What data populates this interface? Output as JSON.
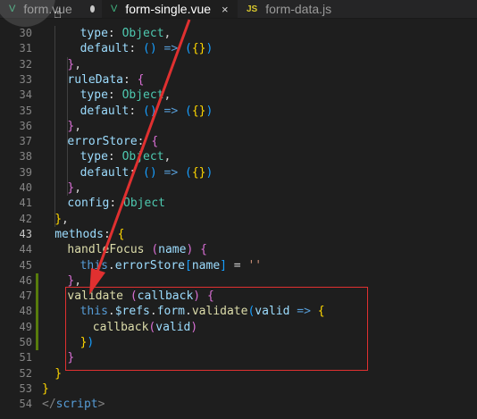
{
  "tabs": [
    {
      "label": "form.vue",
      "type": "vue",
      "modified": true,
      "active": false
    },
    {
      "label": "form-single.vue",
      "type": "vue",
      "modified": false,
      "active": true
    },
    {
      "label": "form-data.js",
      "type": "js",
      "modified": false,
      "active": false
    }
  ],
  "tab_icons": {
    "vue": "V",
    "js": "JS",
    "close": "×"
  },
  "active_line": 43,
  "modified_lines": [
    46,
    47,
    48,
    49,
    50
  ],
  "highlight_box_lines": [
    47,
    52
  ],
  "colors": {
    "highlight_box": "#e03030",
    "arrow": "#e03030",
    "background": "#1e1e1e"
  },
  "code_lines": [
    {
      "n": "30",
      "tokens": [
        [
          "prop",
          "type"
        ],
        [
          "p",
          ": "
        ],
        [
          "type",
          "Object"
        ],
        [
          "p",
          ","
        ]
      ]
    },
    {
      "n": "31",
      "tokens": [
        [
          "prop",
          "default"
        ],
        [
          "p",
          ": "
        ],
        [
          "b3",
          "()"
        ],
        [
          "p",
          " "
        ],
        [
          "kw",
          "=>"
        ],
        [
          "p",
          " "
        ],
        [
          "b3",
          "("
        ],
        [
          "b1",
          "{}"
        ],
        [
          "b3",
          ")"
        ]
      ]
    },
    {
      "n": "32",
      "tokens": [
        [
          "b2",
          "}"
        ],
        [
          "p",
          ","
        ]
      ]
    },
    {
      "n": "33",
      "tokens": [
        [
          "prop",
          "ruleData"
        ],
        [
          "p",
          ": "
        ],
        [
          "b2",
          "{"
        ]
      ]
    },
    {
      "n": "34",
      "tokens": [
        [
          "prop",
          "type"
        ],
        [
          "p",
          ": "
        ],
        [
          "type",
          "Object"
        ],
        [
          "p",
          ","
        ]
      ]
    },
    {
      "n": "35",
      "tokens": [
        [
          "prop",
          "default"
        ],
        [
          "p",
          ": "
        ],
        [
          "b3",
          "()"
        ],
        [
          "p",
          " "
        ],
        [
          "kw",
          "=>"
        ],
        [
          "p",
          " "
        ],
        [
          "b3",
          "("
        ],
        [
          "b1",
          "{}"
        ],
        [
          "b3",
          ")"
        ]
      ]
    },
    {
      "n": "36",
      "tokens": [
        [
          "b2",
          "}"
        ],
        [
          "p",
          ","
        ]
      ]
    },
    {
      "n": "37",
      "tokens": [
        [
          "prop",
          "errorStore"
        ],
        [
          "p",
          ": "
        ],
        [
          "b2",
          "{"
        ]
      ]
    },
    {
      "n": "38",
      "tokens": [
        [
          "prop",
          "type"
        ],
        [
          "p",
          ": "
        ],
        [
          "type",
          "Object"
        ],
        [
          "p",
          ","
        ]
      ]
    },
    {
      "n": "39",
      "tokens": [
        [
          "prop",
          "default"
        ],
        [
          "p",
          ": "
        ],
        [
          "b3",
          "()"
        ],
        [
          "p",
          " "
        ],
        [
          "kw",
          "=>"
        ],
        [
          "p",
          " "
        ],
        [
          "b3",
          "("
        ],
        [
          "b1",
          "{}"
        ],
        [
          "b3",
          ")"
        ]
      ]
    },
    {
      "n": "40",
      "tokens": [
        [
          "b2",
          "}"
        ],
        [
          "p",
          ","
        ]
      ]
    },
    {
      "n": "41",
      "tokens": [
        [
          "prop",
          "config"
        ],
        [
          "p",
          ": "
        ],
        [
          "type",
          "Object"
        ]
      ]
    },
    {
      "n": "42",
      "tokens": [
        [
          "b1",
          "}"
        ],
        [
          "p",
          ","
        ]
      ]
    },
    {
      "n": "43",
      "tokens": [
        [
          "prop",
          "methods"
        ],
        [
          "p",
          ": "
        ],
        [
          "b1",
          "{"
        ]
      ]
    },
    {
      "n": "44",
      "tokens": [
        [
          "fn",
          "handleFocus"
        ],
        [
          "p",
          " "
        ],
        [
          "b2",
          "("
        ],
        [
          "prop",
          "name"
        ],
        [
          "b2",
          ")"
        ],
        [
          "p",
          " "
        ],
        [
          "b2",
          "{"
        ]
      ]
    },
    {
      "n": "45",
      "tokens": [
        [
          "kw",
          "this"
        ],
        [
          "p",
          "."
        ],
        [
          "prop",
          "errorStore"
        ],
        [
          "b3",
          "["
        ],
        [
          "prop",
          "name"
        ],
        [
          "b3",
          "]"
        ],
        [
          "p",
          " = "
        ],
        [
          "str",
          "''"
        ]
      ]
    },
    {
      "n": "46",
      "tokens": [
        [
          "b2",
          "}"
        ],
        [
          "p",
          ","
        ]
      ]
    },
    {
      "n": "47",
      "tokens": [
        [
          "fn",
          "validate"
        ],
        [
          "p",
          " "
        ],
        [
          "b2",
          "("
        ],
        [
          "prop",
          "callback"
        ],
        [
          "b2",
          ")"
        ],
        [
          "p",
          " "
        ],
        [
          "b2",
          "{"
        ]
      ]
    },
    {
      "n": "48",
      "tokens": [
        [
          "kw",
          "this"
        ],
        [
          "p",
          "."
        ],
        [
          "prop",
          "$refs"
        ],
        [
          "p",
          "."
        ],
        [
          "prop",
          "form"
        ],
        [
          "p",
          "."
        ],
        [
          "fn",
          "validate"
        ],
        [
          "b3",
          "("
        ],
        [
          "prop",
          "valid"
        ],
        [
          "p",
          " "
        ],
        [
          "kw",
          "=>"
        ],
        [
          "p",
          " "
        ],
        [
          "b1",
          "{"
        ]
      ]
    },
    {
      "n": "49",
      "tokens": [
        [
          "fn",
          "callback"
        ],
        [
          "b2",
          "("
        ],
        [
          "prop",
          "valid"
        ],
        [
          "b2",
          ")"
        ]
      ]
    },
    {
      "n": "50",
      "tokens": [
        [
          "b1",
          "}"
        ],
        [
          "b3",
          ")"
        ]
      ]
    },
    {
      "n": "51",
      "tokens": [
        [
          "b2",
          "}"
        ]
      ]
    },
    {
      "n": "52",
      "tokens": [
        [
          "b1",
          "}"
        ]
      ]
    },
    {
      "n": "53",
      "tokens": [
        [
          "b1",
          "}"
        ]
      ]
    },
    {
      "n": "54",
      "tokens": [
        [
          "tag",
          "</"
        ],
        [
          "kw",
          "script"
        ],
        [
          "tag",
          ">"
        ]
      ]
    }
  ]
}
